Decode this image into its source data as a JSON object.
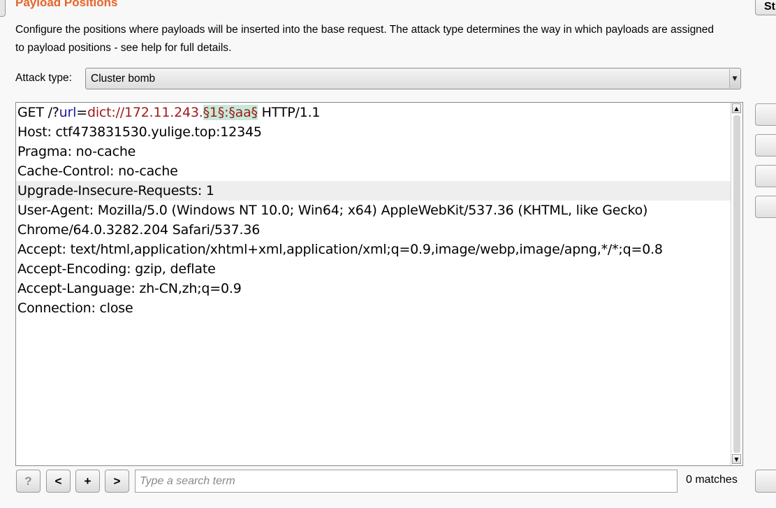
{
  "section": {
    "title": "Payload Positions",
    "description": "Configure the positions where payloads will be inserted into the base request. The attack type determines the way in which payloads are assigned to payload positions - see help for full details."
  },
  "start_button": {
    "label": "St"
  },
  "attack_type": {
    "label": "Attack type:",
    "selected": "Cluster bomb"
  },
  "request": {
    "line1": {
      "method": "GET /?",
      "param": "url",
      "eq": "=",
      "value": "dict://172.11.243.",
      "marker1": "§1§",
      "colon": ":",
      "marker2": "§aa§",
      "version": " HTTP/1.1"
    },
    "lines": [
      "Host: ctf473831530.yulige.top:12345",
      "Pragma: no-cache",
      "Cache-Control: no-cache",
      "Upgrade-Insecure-Requests: 1",
      "User-Agent: Mozilla/5.0 (Windows NT 10.0; Win64; x64) AppleWebKit/537.36 (KHTML, like Gecko)",
      "Chrome/64.0.3282.204 Safari/537.36",
      "Accept: text/html,application/xhtml+xml,application/xml;q=0.9,image/webp,image/apng,*/*;q=0.8",
      "Accept-Encoding: gzip, deflate",
      "Accept-Language: zh-CN,zh;q=0.9",
      "Connection: close"
    ]
  },
  "search": {
    "help_label": "?",
    "prev_label": "<",
    "add_label": "+",
    "next_label": ">",
    "placeholder": "Type a search term",
    "matches": "0 matches"
  }
}
